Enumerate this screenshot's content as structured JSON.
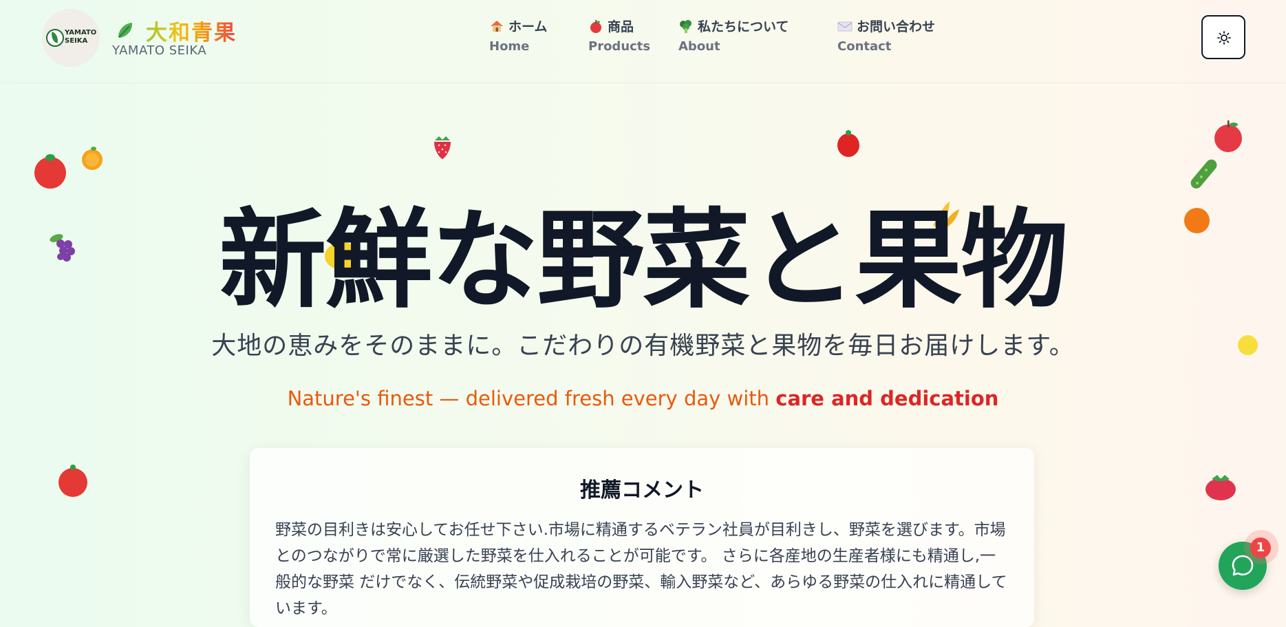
{
  "brand": {
    "logo_text_line1": "YAMATO",
    "logo_text_line2": "SEIKA",
    "title": "大和青果",
    "subtitle": "YAMATO SEIKA",
    "icon": "leafy-vegetable-icon"
  },
  "nav": {
    "items": [
      {
        "label_jp": "ホーム",
        "label_en": "Home",
        "icon": "house-icon"
      },
      {
        "label_jp": "商品",
        "label_en": "Products",
        "icon": "apple-icon"
      },
      {
        "label_jp": "私たちについて",
        "label_en": "About",
        "icon": "broccoli-icon"
      },
      {
        "label_jp": "お問い合わせ",
        "label_en": "Contact",
        "icon": "envelope-icon"
      }
    ]
  },
  "theme_toggle": {
    "icon": "sun-icon"
  },
  "hero": {
    "title": "新鮮な野菜と果物",
    "subtitle": "大地の恵みをそのままに。こだわりの有機野菜と果物を毎日お届けします。",
    "tagline_prefix": "Nature's finest — delivered fresh every day with ",
    "tagline_emphasis": "care and dedication"
  },
  "recommendation": {
    "title": "推薦コメント",
    "body": "野菜の目利きは安心してお任せ下さい.市場に精通するベテラン社員が目利きし、野菜を選びます。市場とのつながりで常に厳選した野菜を仕入れることが可能です。 さらに各産地の生産者様にも精通し,一般的な野菜 だけでなく、伝統野菜や促成栽培の野菜、輸入野菜など、あらゆる野菜の仕入れに精通しています。"
  },
  "chat": {
    "icon": "chat-bubble-icon",
    "badge_count": "1"
  },
  "colors": {
    "accent_green": "#22a55a",
    "tagline_orange": "#ea580c",
    "tagline_red": "#dc2626",
    "badge_red": "#ef4444"
  }
}
